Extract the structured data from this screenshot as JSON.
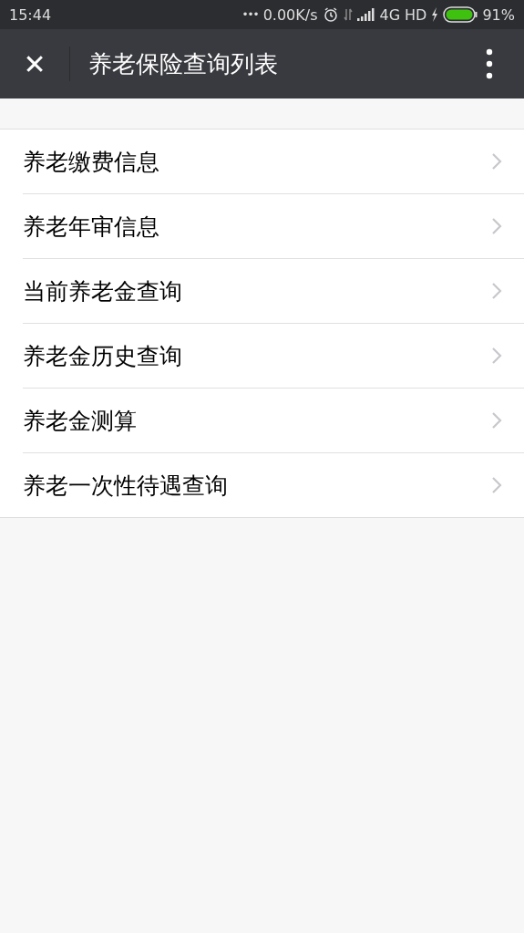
{
  "status_bar": {
    "time": "15:44",
    "dots": "•••",
    "speed": "0.00K/s",
    "network": "4G",
    "hd": "HD",
    "battery": "91%"
  },
  "nav": {
    "close": "✕",
    "title": "养老保险查询列表"
  },
  "items": [
    {
      "label": "养老缴费信息"
    },
    {
      "label": "养老年审信息"
    },
    {
      "label": "当前养老金查询"
    },
    {
      "label": "养老金历史查询"
    },
    {
      "label": "养老金测算"
    },
    {
      "label": "养老一次性待遇查询"
    }
  ]
}
